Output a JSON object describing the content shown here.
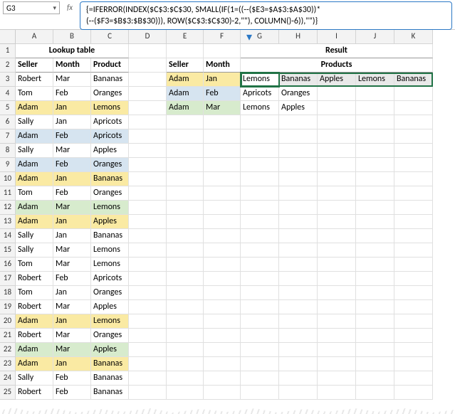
{
  "nameBox": "G3",
  "formulaLine1": "{=IFERROR(INDEX($C$3:$C$30, SMALL(IF(1=((--($E3=$A$3:$A$30))*",
  "formulaLine2": "(--($F3=$B$3:$B$30))), ROW($C$3:$C$30)-2,\"\"), COLUMN()-6)),\"\")}",
  "cols": [
    "A",
    "B",
    "C",
    "D",
    "E",
    "F",
    "G",
    "H",
    "I",
    "J",
    "K"
  ],
  "rows": [
    "1",
    "2",
    "3",
    "4",
    "5",
    "6",
    "7",
    "8",
    "9",
    "10",
    "11",
    "12",
    "13",
    "14",
    "15",
    "16",
    "17",
    "18",
    "19",
    "20",
    "21",
    "22",
    "23",
    "24",
    "25"
  ],
  "lookupTitle": "Lookup table",
  "resultTitle": "Result",
  "productsTitle": "Products",
  "lookupHdr": {
    "a": "Seller",
    "b": "Month",
    "c": "Product"
  },
  "queryHdr": {
    "e": "Seller",
    "f": "Month"
  },
  "lookup": [
    {
      "s": "Robert",
      "m": "Mar",
      "p": "Bananas",
      "hl": ""
    },
    {
      "s": "Tom",
      "m": "Feb",
      "p": "Oranges",
      "hl": ""
    },
    {
      "s": "Adam",
      "m": "Jan",
      "p": "Lemons",
      "hl": "y"
    },
    {
      "s": "Sally",
      "m": "Jan",
      "p": "Apricots",
      "hl": ""
    },
    {
      "s": "Adam",
      "m": "Feb",
      "p": "Apricots",
      "hl": "b"
    },
    {
      "s": "Sally",
      "m": "Mar",
      "p": "Apples",
      "hl": ""
    },
    {
      "s": "Adam",
      "m": "Feb",
      "p": "Oranges",
      "hl": "b"
    },
    {
      "s": "Adam",
      "m": "Jan",
      "p": "Bananas",
      "hl": "y"
    },
    {
      "s": "Tom",
      "m": "Feb",
      "p": "Oranges",
      "hl": ""
    },
    {
      "s": "Adam",
      "m": "Mar",
      "p": "Lemons",
      "hl": "g"
    },
    {
      "s": "Adam",
      "m": "Jan",
      "p": "Apples",
      "hl": "y"
    },
    {
      "s": "Sally",
      "m": "Jan",
      "p": "Bananas",
      "hl": ""
    },
    {
      "s": "Sally",
      "m": "Mar",
      "p": "Lemons",
      "hl": ""
    },
    {
      "s": "Tom",
      "m": "Mar",
      "p": "Lemons",
      "hl": ""
    },
    {
      "s": "Robert",
      "m": "Feb",
      "p": "Apricots",
      "hl": ""
    },
    {
      "s": "Tom",
      "m": "Jan",
      "p": "Oranges",
      "hl": ""
    },
    {
      "s": "Robert",
      "m": "Mar",
      "p": "Apples",
      "hl": ""
    },
    {
      "s": "Adam",
      "m": "Jan",
      "p": "Lemons",
      "hl": "y"
    },
    {
      "s": "Robert",
      "m": "Mar",
      "p": "Oranges",
      "hl": ""
    },
    {
      "s": "Adam",
      "m": "Mar",
      "p": "Apples",
      "hl": "g"
    },
    {
      "s": "Adam",
      "m": "Jan",
      "p": "Bananas",
      "hl": "y"
    },
    {
      "s": "Sally",
      "m": "Feb",
      "p": "Bananas",
      "hl": ""
    },
    {
      "s": "Robert",
      "m": "Feb",
      "p": "Bananas",
      "hl": ""
    }
  ],
  "query": [
    {
      "s": "Adam",
      "m": "Jan",
      "hl": "y"
    },
    {
      "s": "Adam",
      "m": "Feb",
      "hl": "b"
    },
    {
      "s": "Adam",
      "m": "Mar",
      "hl": "g"
    }
  ],
  "results": [
    [
      "Lemons",
      "Bananas",
      "Apples",
      "Lemons",
      "Bananas"
    ],
    [
      "Apricots",
      "Oranges",
      "",
      "",
      ""
    ],
    [
      "Lemons",
      "Apples",
      "",
      "",
      ""
    ]
  ]
}
